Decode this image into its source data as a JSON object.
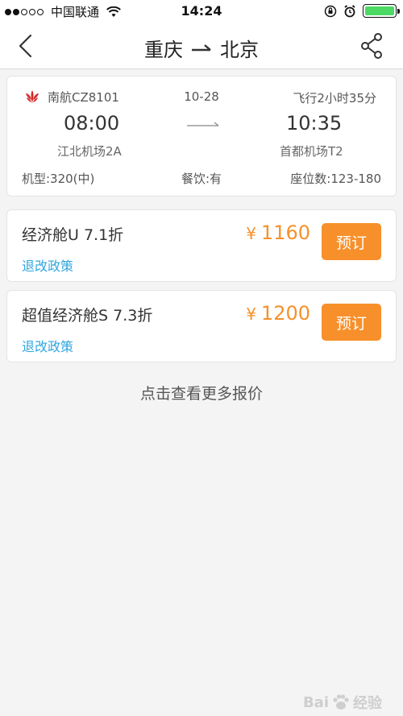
{
  "status_bar": {
    "carrier": "中国联通",
    "time": "14:24"
  },
  "nav": {
    "origin": "重庆",
    "destination": "北京"
  },
  "flight": {
    "airline_flight": "南航CZ8101",
    "date": "10-28",
    "duration": "飞行2小时35分",
    "dep_time": "08:00",
    "arr_time": "10:35",
    "dep_airport": "江北机场2A",
    "arr_airport": "首都机场T2",
    "aircraft": "机型:320(中)",
    "meal": "餐饮:有",
    "seats": "座位数:123-180"
  },
  "fares": [
    {
      "name": "经济舱U 7.1折",
      "currency": "¥",
      "price": "1160",
      "policy": "退改政策",
      "button": "预订"
    },
    {
      "name": "超值经济舱S 7.3折",
      "currency": "¥",
      "price": "1200",
      "policy": "退改政策",
      "button": "预订"
    }
  ],
  "more_link": "点击查看更多报价",
  "watermark": {
    "left": "Bai",
    "right": "经验"
  },
  "colors": {
    "accent": "#f7902b",
    "link": "#2fa7e0",
    "battery": "#4cd964",
    "airline_red": "#d62a2a"
  },
  "icons": [
    "back-chevron-icon",
    "share-icon",
    "airline-logo-icon",
    "wifi-icon",
    "lock-rotation-icon",
    "alarm-icon",
    "battery-icon"
  ]
}
